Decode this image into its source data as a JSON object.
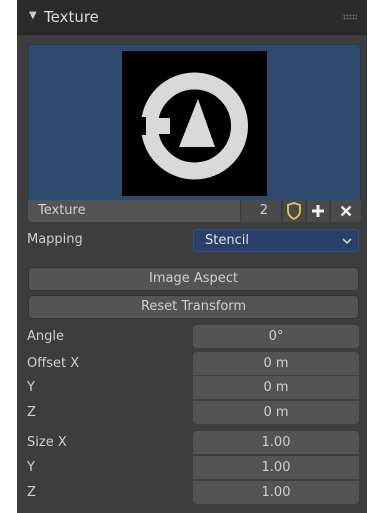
{
  "panel": {
    "title": "Texture",
    "collapse_icon": "triangle-down-icon",
    "grip_icon": "drag-grip-icon"
  },
  "texture": {
    "name": "Texture",
    "users": "2",
    "fake_user_icon": "shield-icon",
    "new_icon": "plus-icon",
    "unlink_icon": "x-icon",
    "preview_icon": "blender-logo-icon"
  },
  "mapping": {
    "label": "Mapping",
    "value": "Stencil"
  },
  "buttons": {
    "image_aspect": "Image Aspect",
    "reset_transform": "Reset Transform"
  },
  "angle": {
    "label": "Angle",
    "value": "0°"
  },
  "offset": {
    "x_label": "Offset X",
    "x_value": "0 m",
    "y_label": "Y",
    "y_value": "0 m",
    "z_label": "Z",
    "z_value": "0 m"
  },
  "size": {
    "x_label": "Size X",
    "x_value": "1.00",
    "y_label": "Y",
    "y_value": "1.00",
    "z_label": "Z",
    "z_value": "1.00"
  },
  "colors": {
    "panel_bg": "#3d3d3d",
    "header_bg": "#2b2b2b",
    "preview_bg": "#2e4a6c",
    "field_bg": "#545454",
    "dropdown_bg": "#28406a",
    "shield_accent": "#e8c84a"
  }
}
